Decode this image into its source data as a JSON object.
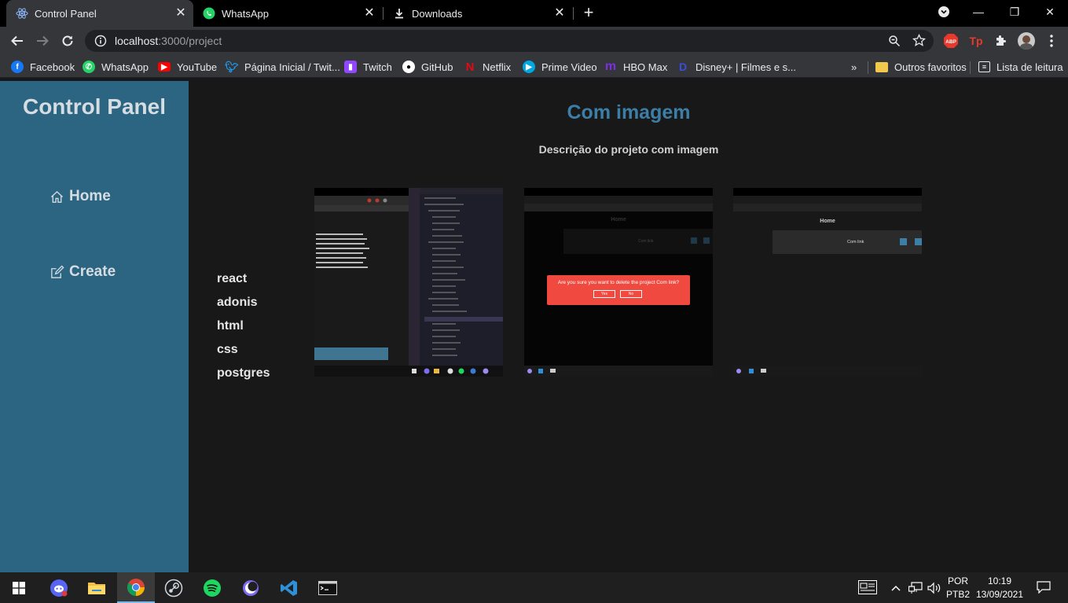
{
  "browser": {
    "tabs": [
      {
        "title": "Control Panel",
        "icon": "react-icon"
      },
      {
        "title": "WhatsApp",
        "icon": "whatsapp-icon"
      },
      {
        "title": "Downloads",
        "icon": "download-icon"
      }
    ],
    "url_host": "localhost",
    "url_rest": ":3000/project",
    "bookmarks": [
      {
        "label": "Facebook",
        "color": "#1877f2"
      },
      {
        "label": "WhatsApp",
        "color": "#25d366"
      },
      {
        "label": "YouTube",
        "color": "#ff0000"
      },
      {
        "label": "Página Inicial / Twit...",
        "color": "#1d9bf0"
      },
      {
        "label": "Twitch",
        "color": "#9146ff"
      },
      {
        "label": "GitHub",
        "color": "#ffffff"
      },
      {
        "label": "Netflix",
        "color": "#e50914"
      },
      {
        "label": "Prime Video",
        "color": "#00a8e1"
      },
      {
        "label": "HBO Max",
        "color": "#7b2fe0"
      },
      {
        "label": "Disney+ | Filmes e s...",
        "color": "#1a2bb0"
      }
    ],
    "other_bookmarks": "Outros favoritos",
    "reading_list": "Lista de leitura"
  },
  "sidebar": {
    "title": "Control Panel",
    "items": [
      {
        "label": "Home",
        "icon": "home-icon"
      },
      {
        "label": "Create",
        "icon": "edit-icon"
      }
    ]
  },
  "project": {
    "title": "Com imagem",
    "description": "Descrição do projeto com imagem",
    "technologies": [
      "react",
      "adonis",
      "html",
      "css",
      "postgres"
    ],
    "thumbnails": [
      {
        "kind": "vscode-screenshot"
      },
      {
        "kind": "delete-confirm-screenshot",
        "dialog_text": "Are you sure you want to delete the project Com link?",
        "yes": "Yes",
        "no": "No",
        "heading": "Home",
        "item": "Com link"
      },
      {
        "kind": "home-screenshot",
        "heading": "Home",
        "item": "Com link"
      }
    ]
  },
  "taskbar": {
    "lang_top": "POR",
    "lang_bottom": "PTB2",
    "time": "10:19",
    "date": "13/09/2021"
  },
  "colors": {
    "sidebar_bg": "#2b6582",
    "title_accent": "#3d7ea6",
    "page_bg": "#181818"
  }
}
